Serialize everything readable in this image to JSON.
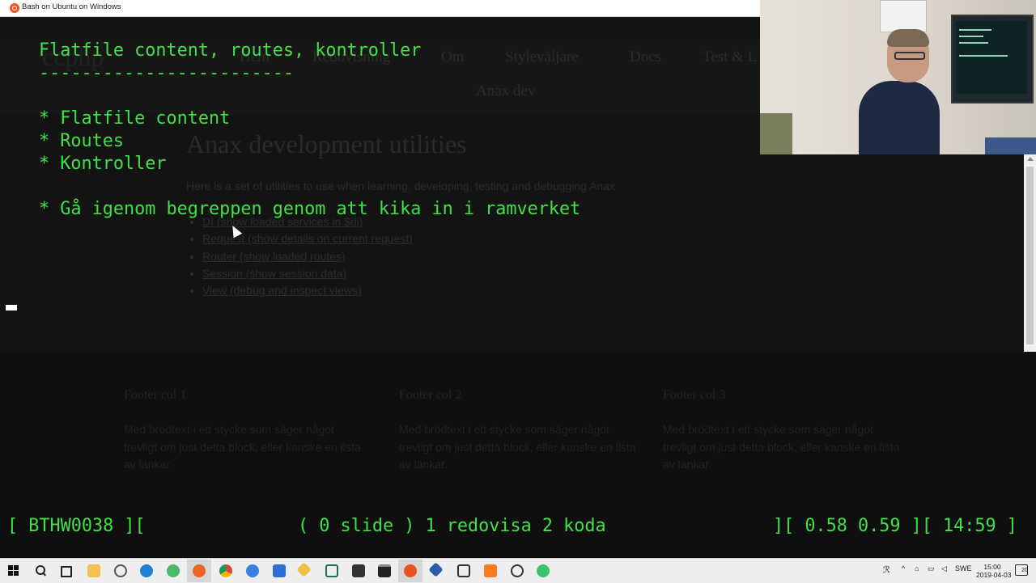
{
  "window": {
    "title": "Bash on Ubuntu on Windows"
  },
  "slide": {
    "title": "Flatfile content, routes, kontroller",
    "underline": "------------------------",
    "items": [
      "* Flatfile content",
      "* Routes",
      "* Kontroller",
      "* Gå igenom begreppen genom att kika in i ramverket"
    ]
  },
  "status_bar": {
    "left": "[ BTHW0038 ][",
    "middle": "( 0 slide ) 1 redovisa 2 koda",
    "right": "][ 0.58 0.59 ][ 14:59 ]"
  },
  "background_page": {
    "logo": "ccphp",
    "nav": [
      "Hem",
      "Redovisning",
      "Om",
      "Styleväljare",
      "Docs",
      "Test & L"
    ],
    "subnav": "Anax dev",
    "heading": "Anax development utilities",
    "intro": "Here is a set of utilities to use when learning, developing, testing and debugging Anax.",
    "links": [
      "DI (show loaded services in $di)",
      "Request (show details on current request)",
      "Router (show loaded routes)",
      "Session (show session data)",
      "View (debug and inspect views)"
    ],
    "footer": [
      {
        "heading": "Footer col 1",
        "text": "Med brödtext i ett stycke som säger något trevligt om just detta block, eller kanske en lista av länkar."
      },
      {
        "heading": "Footer col 2",
        "text": "Med brödtext i ett stycke som säger något trevligt om just detta block, eller kanske en lista av länkar."
      },
      {
        "heading": "Footer col 3",
        "text": "Med brödtext i ett stycke som säger något trevligt om just detta block, eller kanske en lista av länkar."
      }
    ]
  },
  "taskbar": {
    "icons": [
      "windows-start-icon",
      "search-icon",
      "task-view-icon",
      "file-explorer-icon",
      "settings-icon",
      "edge-icon",
      "app-green-icon",
      "firefox-icon",
      "chrome-icon",
      "chrome-blue-icon",
      "store-icon",
      "git-icon",
      "editor-icon",
      "terminal-icon",
      "cmd-icon",
      "ubuntu-icon",
      "virtualbox-icon",
      "app-icon",
      "xampp-icon",
      "obs-icon",
      "app-green2-icon"
    ],
    "tray": {
      "language": "SWE",
      "time": "15:00",
      "date": "2019-04-03",
      "notification_count": "20"
    }
  },
  "colors": {
    "terminal_text": "#41e046",
    "terminal_bg": "#0c0c0c",
    "ubuntu_orange": "#e95420"
  }
}
